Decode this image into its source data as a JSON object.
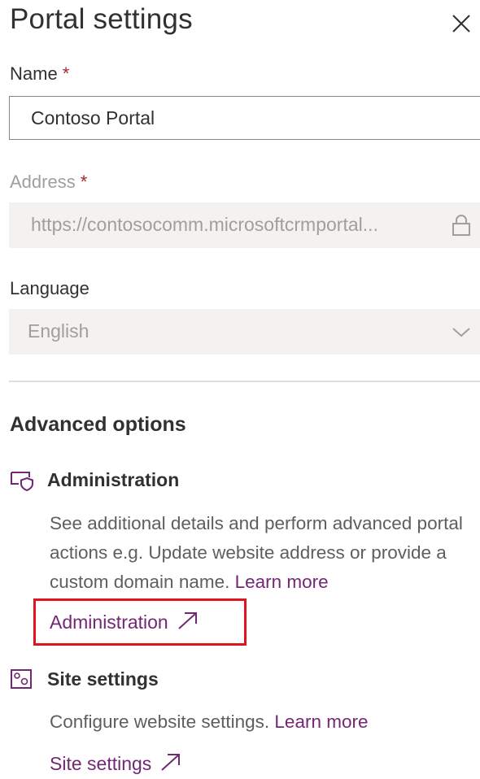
{
  "panel": {
    "title": "Portal settings",
    "close_icon": "close-icon"
  },
  "name_field": {
    "label": "Name",
    "required_mark": "*",
    "value": "Contoso Portal"
  },
  "address_field": {
    "label": "Address",
    "required_mark": "*",
    "value": "https://contosocomm.microsoftcrmportal...",
    "icon": "lock-icon",
    "disabled": true
  },
  "language_field": {
    "label": "Language",
    "value": "English",
    "icon": "chevron-down-icon",
    "disabled": true
  },
  "advanced": {
    "title": "Advanced options",
    "administration": {
      "icon": "admin-shield-icon",
      "title": "Administration",
      "description": "See additional details and perform advanced portal actions e.g. Update website address or provide a custom domain name.",
      "learn_more": "Learn more",
      "link_label": "Administration",
      "link_icon": "external-arrow-icon",
      "highlighted": true,
      "highlight_color": "#e0141e"
    },
    "site_settings": {
      "icon": "site-settings-icon",
      "title": "Site settings",
      "description": "Configure website settings.",
      "learn_more": "Learn more",
      "link_label": "Site settings",
      "link_icon": "external-arrow-icon"
    }
  },
  "colors": {
    "link": "#742774",
    "required": "#a4262c",
    "disabled_fill": "#f3f2f1",
    "disabled_text": "#a19f9d"
  }
}
